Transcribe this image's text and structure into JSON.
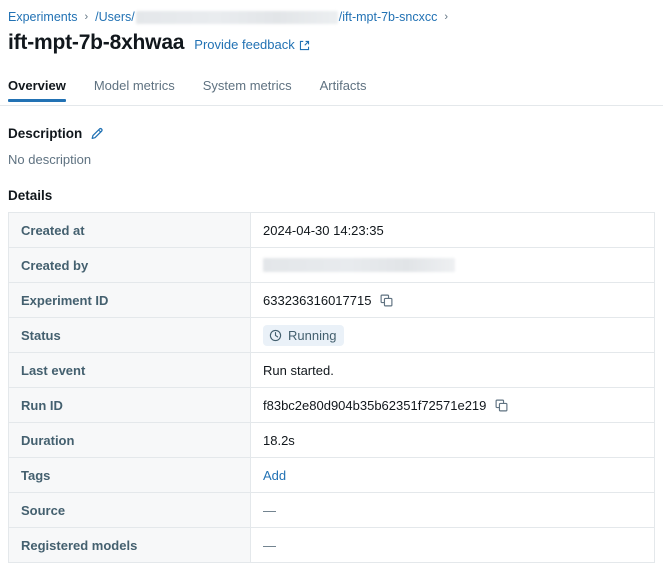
{
  "breadcrumb": {
    "items": [
      {
        "label": "Experiments",
        "type": "link"
      },
      {
        "label": "/Users/",
        "type": "link_prefix"
      },
      {
        "label": "/ift-mpt-7b-sncxcc",
        "type": "link_suffix"
      }
    ],
    "separator": "›",
    "redacted": true
  },
  "header": {
    "title": "ift-mpt-7b-8xhwaa",
    "feedback_label": "Provide feedback",
    "feedback_icon": "external-link-icon"
  },
  "tabs": [
    {
      "label": "Overview",
      "active": true
    },
    {
      "label": "Model metrics",
      "active": false
    },
    {
      "label": "System metrics",
      "active": false
    },
    {
      "label": "Artifacts",
      "active": false
    }
  ],
  "description": {
    "heading": "Description",
    "edit_icon": "pencil-icon",
    "empty_text": "No description"
  },
  "details": {
    "heading": "Details",
    "rows": [
      {
        "key": "Created at",
        "value": "2024-04-30 14:23:35",
        "kind": "text"
      },
      {
        "key": "Created by",
        "value": "",
        "kind": "redacted"
      },
      {
        "key": "Experiment ID",
        "value": "633236316017715",
        "kind": "copyable",
        "copy_icon": "copy-icon"
      },
      {
        "key": "Status",
        "value": "Running",
        "kind": "badge",
        "badge_icon": "clock-icon"
      },
      {
        "key": "Last event",
        "value": "Run started.",
        "kind": "text"
      },
      {
        "key": "Run ID",
        "value": "f83bc2e80d904b35b62351f72571e219",
        "kind": "copyable",
        "copy_icon": "copy-icon"
      },
      {
        "key": "Duration",
        "value": "18.2s",
        "kind": "text"
      },
      {
        "key": "Tags",
        "value": "Add",
        "kind": "link"
      },
      {
        "key": "Source",
        "value": "—",
        "kind": "dash"
      },
      {
        "key": "Registered models",
        "value": "—",
        "kind": "dash"
      }
    ]
  },
  "colors": {
    "accent": "#2272b4",
    "text": "#11171c",
    "muted": "#5f7281",
    "key_text": "#44606f",
    "border": "#e4e8eb",
    "key_bg": "#f7f8f9",
    "badge_bg": "#eaf1f8"
  }
}
